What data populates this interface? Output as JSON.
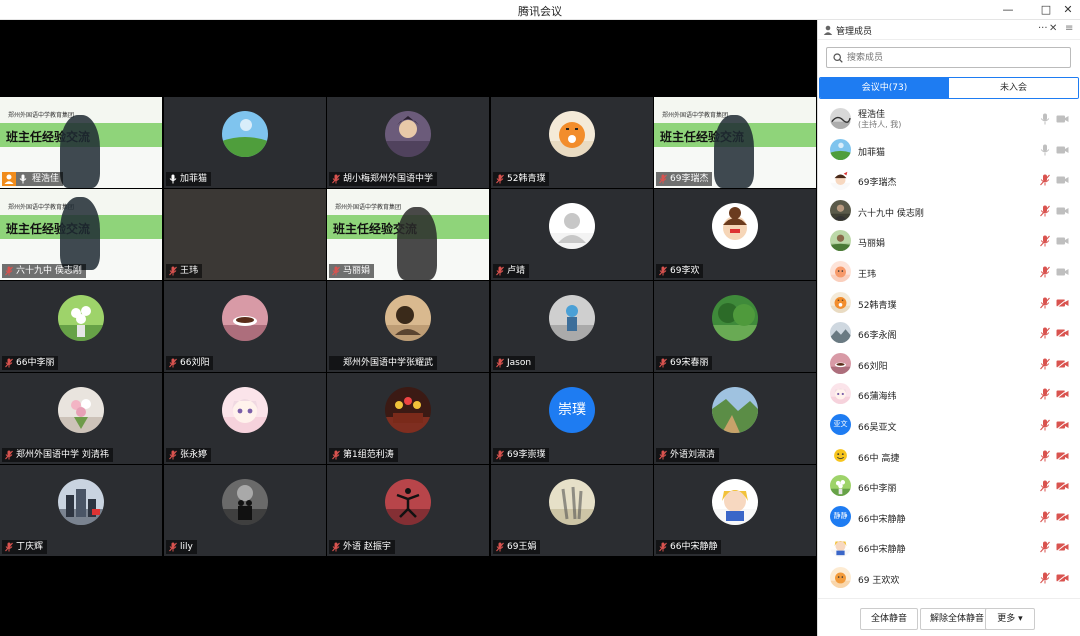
{
  "window": {
    "title": "腾讯会议",
    "min_glyph": "—",
    "max_glyph": "□",
    "close_glyph": "✕"
  },
  "colors": {
    "accent": "#1e7cf2",
    "host_badge": "#f08c1c",
    "muted_red": "#d9534f",
    "stage_bg": "#000000",
    "tile_bg": "#2b2d31"
  },
  "slide": {
    "school": "郑州外国语中学教育集团",
    "title": "班主任经验交流"
  },
  "tiles": [
    {
      "name": "程浩佳",
      "kind": "slide",
      "mic": "on",
      "host": true
    },
    {
      "name": "加菲猫",
      "kind": "avatar",
      "mic": "on",
      "icon": "meadow-photo"
    },
    {
      "name": "胡小梅郑州外国语中学",
      "kind": "avatar",
      "mic": "muted",
      "icon": "anime-character"
    },
    {
      "name": "52韩青璞",
      "kind": "avatar",
      "mic": "muted",
      "icon": "tiger-cartoon"
    },
    {
      "name": "69李瑞杰",
      "kind": "slide",
      "mic": "muted"
    },
    {
      "name": "六十九中  侯志刚",
      "kind": "slide",
      "mic": "muted"
    },
    {
      "name": "王玮",
      "kind": "dark",
      "mic": "muted"
    },
    {
      "name": "马丽娟",
      "kind": "slide",
      "mic": "muted"
    },
    {
      "name": "卢靖",
      "kind": "avatar",
      "mic": "muted",
      "icon": "default-user"
    },
    {
      "name": "69李欢",
      "kind": "avatar",
      "mic": "muted",
      "icon": "girl-cartoon"
    },
    {
      "name": "66中李丽",
      "kind": "avatar",
      "mic": "muted",
      "icon": "flower-vase"
    },
    {
      "name": "66刘阳",
      "kind": "avatar",
      "mic": "muted",
      "icon": "coffee-cup"
    },
    {
      "name": "郑州外国语中学张耀武",
      "kind": "avatar",
      "mic": "none",
      "icon": "sketch-portrait"
    },
    {
      "name": "Jason",
      "kind": "avatar",
      "mic": "muted",
      "icon": "child-photo"
    },
    {
      "name": "69宋春丽",
      "kind": "avatar",
      "mic": "muted",
      "icon": "forest-photo"
    },
    {
      "name": "郑州外国语中学  刘清祎",
      "kind": "avatar",
      "mic": "muted",
      "icon": "bouquet-photo"
    },
    {
      "name": "张永婷",
      "kind": "avatar",
      "mic": "muted",
      "icon": "anime-girl"
    },
    {
      "name": "第1组范利涛",
      "kind": "avatar",
      "mic": "muted",
      "icon": "group-photo"
    },
    {
      "name": "69李崇璞",
      "kind": "text-avatar",
      "avatar_text": "崇璞",
      "mic": "muted"
    },
    {
      "name": "外语刘淑清",
      "kind": "avatar",
      "mic": "muted",
      "icon": "valley-photo"
    },
    {
      "name": "丁庆辉",
      "kind": "avatar",
      "mic": "muted",
      "icon": "city-photo"
    },
    {
      "name": "lily",
      "kind": "avatar",
      "mic": "muted",
      "icon": "couple-silhouette"
    },
    {
      "name": "外语 赵振宇",
      "kind": "avatar",
      "mic": "muted",
      "icon": "jumping-person"
    },
    {
      "name": "69王娟",
      "kind": "avatar",
      "mic": "muted",
      "icon": "shadow-photo"
    },
    {
      "name": "66中宋静静",
      "kind": "avatar",
      "mic": "muted",
      "icon": "blonde-doll"
    }
  ],
  "panel": {
    "title": "管理成员",
    "more_glyph": "···",
    "close_glyph": "✕",
    "menu_glyph": "≡",
    "search_placeholder": "搜索成员",
    "tab_active": "会议中(73)",
    "tab_inactive": "未入会",
    "members": [
      {
        "name": "程浩佳",
        "sub": "(主持人, 我)",
        "mic": "on",
        "cam": "on",
        "icon": "ink-painting"
      },
      {
        "name": "加菲猫",
        "mic": "on",
        "cam": "on",
        "icon": "meadow-photo"
      },
      {
        "name": "69李瑞杰",
        "mic": "muted",
        "cam": "on",
        "icon": "cartoon-face"
      },
      {
        "name": "六十九中  侯志刚",
        "mic": "muted",
        "cam": "on",
        "icon": "man-photo"
      },
      {
        "name": "马丽娟",
        "mic": "muted",
        "cam": "on",
        "icon": "landscape-photo"
      },
      {
        "name": "王玮",
        "mic": "muted",
        "cam": "on",
        "icon": "peach-cartoon"
      },
      {
        "name": "52韩青璞",
        "mic": "muted",
        "cam": "off",
        "icon": "tiger-cartoon"
      },
      {
        "name": "66李永阁",
        "mic": "muted",
        "cam": "off",
        "icon": "mountain-photo"
      },
      {
        "name": "66刘阳",
        "mic": "muted",
        "cam": "off",
        "icon": "coffee-cup"
      },
      {
        "name": "66蒲海纬",
        "mic": "muted",
        "cam": "off",
        "icon": "anime-girl"
      },
      {
        "name": "66吴亚文",
        "avatar_text": "亚文",
        "mic": "muted",
        "cam": "off"
      },
      {
        "name": "66中 高捷",
        "mic": "muted",
        "cam": "off",
        "icon": "yellow-emoji"
      },
      {
        "name": "66中李丽",
        "mic": "muted",
        "cam": "off",
        "icon": "flower-vase"
      },
      {
        "name": "66中宋静静",
        "avatar_text": "静静",
        "mic": "muted",
        "cam": "off"
      },
      {
        "name": "66中宋静静",
        "mic": "muted",
        "cam": "off",
        "icon": "blonde-doll"
      },
      {
        "name": "69 王欢欢",
        "mic": "muted",
        "cam": "off",
        "icon": "orange-cartoon"
      }
    ],
    "footer": {
      "mute_all": "全体静音",
      "unmute_all": "解除全体静音",
      "more": "更多 ▾"
    }
  }
}
